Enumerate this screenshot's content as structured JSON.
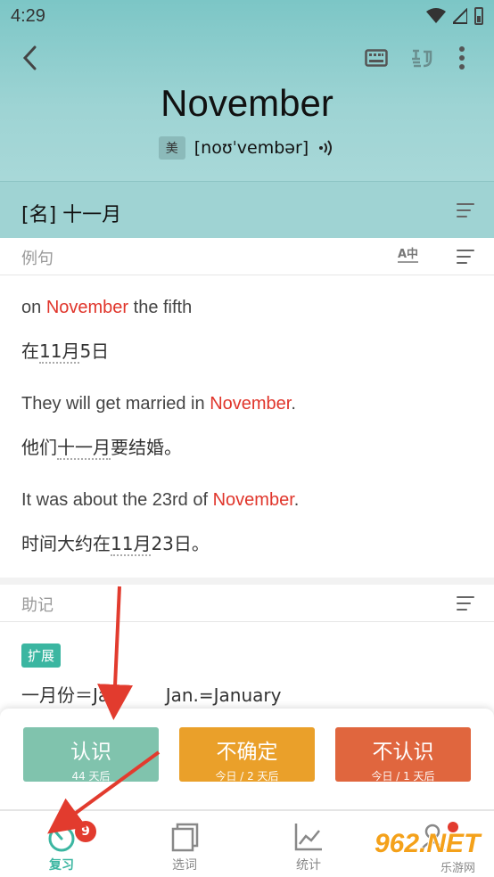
{
  "status": {
    "time": "4:29"
  },
  "word": {
    "text": "November",
    "accent": "美",
    "phonetic": "[noʊˈvembər]"
  },
  "meaning": "[名] 十一月",
  "examples_section": {
    "label": "例句",
    "translate_icon": "A中"
  },
  "examples": [
    {
      "en_pre": "on ",
      "en_hl": "November",
      "en_post": " the fifth",
      "zh_pre": "在",
      "zh_dot": "11月",
      "zh_post": "5日"
    },
    {
      "en_pre": "They will get married in ",
      "en_hl": "November",
      "en_post": ".",
      "zh_pre": "他们",
      "zh_dot": "十一月",
      "zh_post": "要结婚。"
    },
    {
      "en_pre": "It was about the 23rd of ",
      "en_hl": "November",
      "en_post": ".",
      "zh_pre": "时间大约在",
      "zh_dot": "11月",
      "zh_post": "23日。"
    }
  ],
  "mnemonic_section": {
    "label": "助记",
    "tag": "扩展",
    "line": "一月份＝Jan.       Jan.=January"
  },
  "actions": {
    "know": {
      "label": "认识",
      "sub": "44 天后"
    },
    "unsure": {
      "label": "不确定",
      "sub": "今日 / 2 天后"
    },
    "unknown": {
      "label": "不认识",
      "sub": "今日 / 1 天后"
    }
  },
  "nav": {
    "review": {
      "label": "复习",
      "badge": "9"
    },
    "select": {
      "label": "选词"
    },
    "stats": {
      "label": "统计"
    },
    "mine": {
      "label": ""
    }
  },
  "watermark": {
    "main": "962.NET",
    "sub": "乐游网"
  },
  "colors": {
    "accent_teal": "#3bb6a1",
    "highlight_red": "#e0352b",
    "annotation_red": "#e23b2e"
  }
}
